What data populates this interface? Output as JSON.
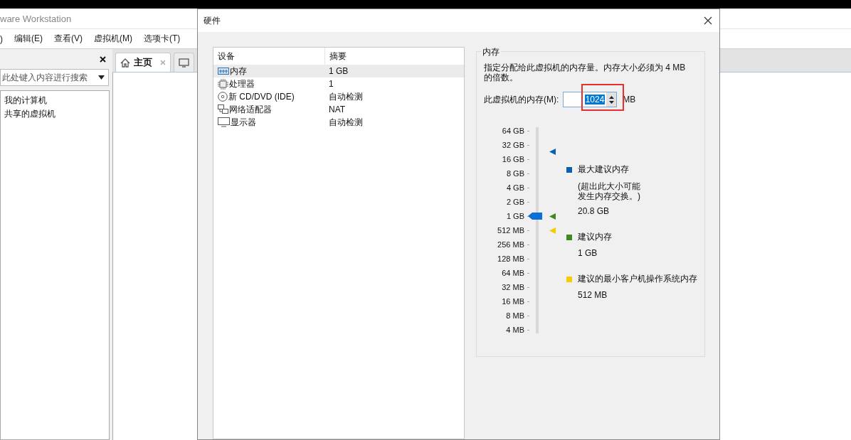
{
  "app": {
    "title": "ware Workstation",
    "menu": [
      ")",
      "编辑(E)",
      "查看(V)",
      "虚拟机(M)",
      "选项卡(T)"
    ],
    "library": {
      "search": {
        "placeholder": "此处键入内容进行搜索"
      },
      "items": [
        {
          "label": "我的计算机"
        },
        {
          "label": "共享的虚拟机"
        }
      ]
    },
    "tabs": [
      {
        "label": "主页",
        "kind": "home",
        "selected": true
      },
      {
        "kind": "vm",
        "selected": false
      }
    ]
  },
  "dialog": {
    "title": "硬件",
    "devices": {
      "columns": [
        "设备",
        "摘要"
      ],
      "rows": [
        {
          "kind": "memory",
          "device": "内存",
          "summary": "1 GB",
          "selected": true
        },
        {
          "kind": "cpu",
          "device": "处理器",
          "summary": "1",
          "selected": false
        },
        {
          "kind": "cdrom",
          "device": "新 CD/DVD (IDE)",
          "summary": "自动检测",
          "selected": false
        },
        {
          "kind": "network",
          "device": "网络适配器",
          "summary": "NAT",
          "selected": false
        },
        {
          "kind": "display",
          "device": "显示器",
          "summary": "自动检测",
          "selected": false
        }
      ]
    },
    "memory": {
      "group_title": "内存",
      "description": "指定分配给此虚拟机的内存量。内存大小必须为 4 MB 的倍数。",
      "field_label": "此虚拟机的内存(M):",
      "value": "1024",
      "unit": "MB",
      "highlighted": true,
      "scale": [
        "64 GB",
        "32 GB",
        "16 GB",
        "8 GB",
        "4 GB",
        "2 GB",
        "1 GB",
        "512 MB",
        "256 MB",
        "128 MB",
        "64 MB",
        "32 MB",
        "16 MB",
        "8 MB",
        "4 MB"
      ],
      "level": 0.571,
      "legend": [
        {
          "title": "最大建议内存",
          "note": "(超出此大小可能发生内存交换。)",
          "value": "20.8 GB",
          "color": "#0b5fb0",
          "level": 0.893
        },
        {
          "title": "建议内存",
          "value": "1 GB",
          "color": "#3f8a1e",
          "level": 0.571
        },
        {
          "title": "建议的最小客户机操作系统内存",
          "value": "512 MB",
          "color": "#f5cc00",
          "level": 0.5
        }
      ]
    }
  }
}
